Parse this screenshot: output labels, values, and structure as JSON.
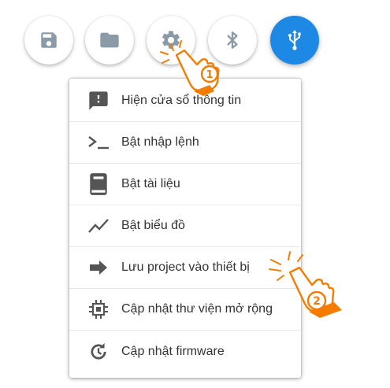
{
  "toolbar": {
    "buttons": [
      {
        "icon": "save-icon"
      },
      {
        "icon": "folder-icon"
      },
      {
        "icon": "gear-icon"
      },
      {
        "icon": "bluetooth-icon"
      },
      {
        "icon": "usb-icon",
        "active": true
      }
    ]
  },
  "menu": {
    "items": [
      {
        "icon": "message-alert-icon",
        "label": "Hiện cửa sổ thông tin"
      },
      {
        "icon": "terminal-icon",
        "label": "Bật nhập lệnh"
      },
      {
        "icon": "book-icon",
        "label": "Bật tài liệu"
      },
      {
        "icon": "chart-line-icon",
        "label": "Bật biểu đồ"
      },
      {
        "icon": "arrow-right-icon",
        "label": "Lưu project vào thiết bị"
      },
      {
        "icon": "chip-icon",
        "label": "Cập nhật thư viện mở rộng"
      },
      {
        "icon": "update-icon",
        "label": "Cập nhật firmware"
      }
    ]
  },
  "annotations": [
    {
      "icon": "pointing-hand-icon",
      "step": "1"
    },
    {
      "icon": "pointing-hand-icon",
      "step": "2"
    }
  ],
  "colors": {
    "accent": "#1e88e5",
    "icon_gray": "#8a9aa6",
    "annotation_orange": "#f57c00",
    "text": "#333333"
  }
}
